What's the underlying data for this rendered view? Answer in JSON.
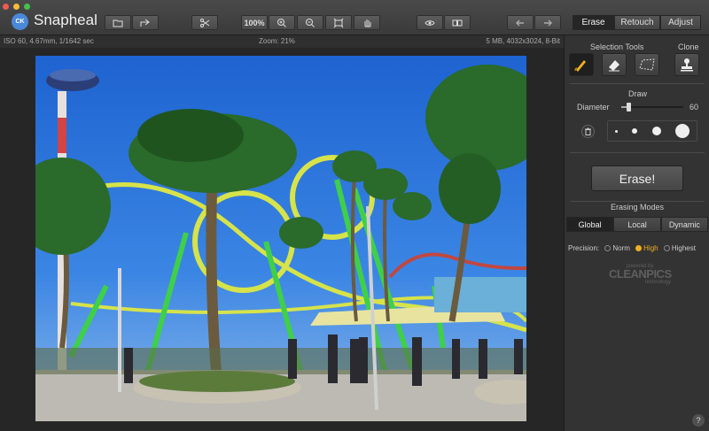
{
  "app": {
    "title": "Snapheal",
    "logo_text": "CK"
  },
  "toolbar": {
    "zoom_label": "100%",
    "tabs": [
      {
        "label": "Erase",
        "active": true
      },
      {
        "label": "Retouch",
        "active": false
      },
      {
        "label": "Adjust",
        "active": false
      }
    ]
  },
  "infobar": {
    "camera": "ISO 60, 4.67mm, 1/1642 sec",
    "zoom": "Zoom: 21%",
    "file": "5 MB, 4032x3024, 8-Bit"
  },
  "panel": {
    "selection_tools_label": "Selection Tools",
    "clone_label": "Clone",
    "draw_label": "Draw",
    "diameter_label": "Diameter",
    "diameter_value": "60",
    "diameter_fraction": 0.12,
    "erase_button": "Erase!",
    "erasing_modes_label": "Erasing Modes",
    "modes": [
      {
        "label": "Global",
        "active": true
      },
      {
        "label": "Local",
        "active": false
      },
      {
        "label": "Dynamic",
        "active": false
      }
    ],
    "precision_label": "Precision:",
    "precision_options": [
      {
        "label": "Norm",
        "selected": false
      },
      {
        "label": "High",
        "selected": true
      },
      {
        "label": "Highest",
        "selected": false
      }
    ],
    "powered_by": "powered by",
    "cleanpics": "CLEANPICS",
    "technology": "technology",
    "help": "?"
  },
  "colors": {
    "accent_yellow": "#f0b020",
    "logo_blue": "#4a88d8",
    "sky": "#2a6fd6",
    "coaster_green": "#3fcf4a",
    "coaster_yellow": "#d6e34a"
  }
}
